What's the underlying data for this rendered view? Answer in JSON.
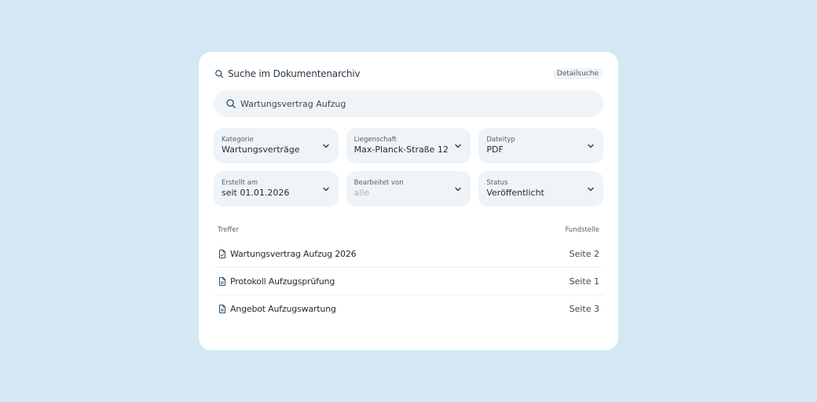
{
  "header": {
    "title": "Suche im Dokumentenarchiv",
    "advanced_link": "Detailsuche"
  },
  "search": {
    "value": "Wartungsvertrag Aufzug"
  },
  "filters": [
    {
      "label": "Kategorie",
      "value": "Wartungsverträge"
    },
    {
      "label": "Liegenschaft",
      "value": "Max-Planck-Straße 12"
    },
    {
      "label": "Dateityp",
      "value": "PDF"
    },
    {
      "label": "Erstellt am",
      "value": "seit 01.01.2026"
    },
    {
      "label": "Bearbeitet von",
      "value": "alle"
    },
    {
      "label": "Status",
      "value": "Veröffentlicht"
    }
  ],
  "results": {
    "header_left": "Treffer",
    "header_right": "Fundstelle",
    "items": [
      {
        "title": "Wartungsvertrag Aufzug 2026",
        "page": "Seite 2",
        "icon": "file-check-icon"
      },
      {
        "title": "Protokoll Aufzugsprüfung",
        "page": "Seite 1",
        "icon": "file-text-icon"
      },
      {
        "title": "Angebot Aufzugswartung",
        "page": "Seite 3",
        "icon": "file-text-icon"
      }
    ]
  },
  "colors": {
    "background": "#d3e8f3",
    "card": "#ffffff",
    "field": "#eef4f8",
    "icon": "#2f4a66"
  }
}
